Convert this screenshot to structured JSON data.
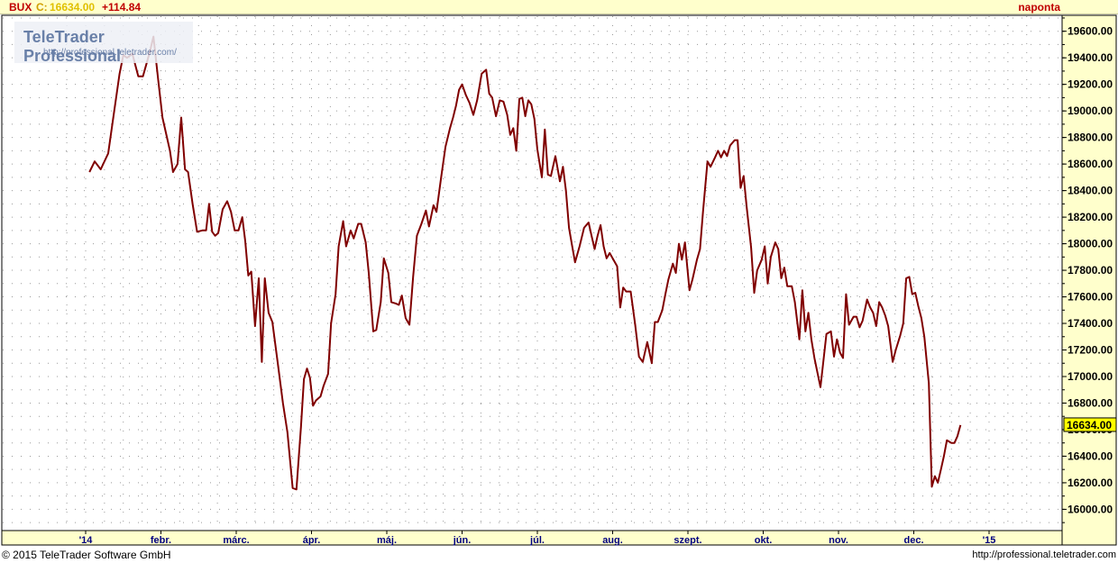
{
  "header": {
    "symbol": "BUX",
    "close_prefix": "C:",
    "close_value": "16634.00",
    "change": "+114.84",
    "interval": "naponta"
  },
  "logo": {
    "name": "TeleTrader Professional",
    "url": "http://professional.teletrader.com/"
  },
  "footer": {
    "copyright": "© 2015 TeleTrader Software GmbH",
    "url": "http://professional.teletrader.com"
  },
  "colors": {
    "line": "#800000",
    "grid": "#999999",
    "axis_strip": "#ffffcc",
    "x_labels": "#000080",
    "last_price_bg": "#ffff00"
  },
  "chart_data": {
    "type": "line",
    "title": "BUX",
    "last_price_label": "16634.00",
    "x_tick_labels": [
      "'14",
      "febr.",
      "márc.",
      "ápr.",
      "máj.",
      "jún.",
      "júl.",
      "aug.",
      "szept.",
      "okt.",
      "nov.",
      "dec.",
      "'15"
    ],
    "x_tick_month_index": [
      0,
      1,
      2,
      3,
      4,
      5,
      6,
      7,
      8,
      9,
      10,
      11,
      12
    ],
    "y_ticks": [
      16000,
      16200,
      16400,
      16600,
      16800,
      17000,
      17200,
      17400,
      17600,
      17800,
      18000,
      18200,
      18400,
      18600,
      18800,
      19000,
      19200,
      19400,
      19600
    ],
    "y_tick_labels": [
      "16000.00",
      "16200.00",
      "16400.00",
      "16600.00",
      "16800.00",
      "17000.00",
      "17200.00",
      "17400.00",
      "17600.00",
      "17800.00",
      "18000.00",
      "18200.00",
      "18400.00",
      "18600.00",
      "18800.00",
      "19000.00",
      "19200.00",
      "19400.00",
      "19600.00"
    ],
    "ylim": [
      15840,
      19720
    ],
    "xlim_months": [
      -0.1,
      12.25
    ],
    "grid": true,
    "series": [
      {
        "values": [
          [
            0.05,
            18540
          ],
          [
            0.12,
            18620
          ],
          [
            0.2,
            18560
          ],
          [
            0.3,
            18680
          ],
          [
            0.38,
            19000
          ],
          [
            0.45,
            19280
          ],
          [
            0.5,
            19420
          ],
          [
            0.55,
            19400
          ],
          [
            0.62,
            19430
          ],
          [
            0.7,
            19260
          ],
          [
            0.76,
            19260
          ],
          [
            0.85,
            19440
          ],
          [
            0.9,
            19560
          ],
          [
            0.96,
            19250
          ],
          [
            1.02,
            18950
          ],
          [
            1.08,
            18800
          ],
          [
            1.12,
            18700
          ],
          [
            1.16,
            18540
          ],
          [
            1.22,
            18600
          ],
          [
            1.27,
            18950
          ],
          [
            1.32,
            18560
          ],
          [
            1.36,
            18540
          ],
          [
            1.42,
            18300
          ],
          [
            1.48,
            18090
          ],
          [
            1.55,
            18100
          ],
          [
            1.6,
            18100
          ],
          [
            1.64,
            18300
          ],
          [
            1.68,
            18090
          ],
          [
            1.72,
            18060
          ],
          [
            1.76,
            18080
          ],
          [
            1.82,
            18260
          ],
          [
            1.88,
            18320
          ],
          [
            1.93,
            18240
          ],
          [
            1.98,
            18100
          ],
          [
            2.03,
            18100
          ],
          [
            2.08,
            18200
          ],
          [
            2.12,
            18020
          ],
          [
            2.16,
            17760
          ],
          [
            2.2,
            17790
          ],
          [
            2.25,
            17380
          ],
          [
            2.3,
            17740
          ],
          [
            2.34,
            17110
          ],
          [
            2.38,
            17740
          ],
          [
            2.43,
            17480
          ],
          [
            2.48,
            17410
          ],
          [
            2.55,
            17110
          ],
          [
            2.62,
            16800
          ],
          [
            2.68,
            16580
          ],
          [
            2.75,
            16160
          ],
          [
            2.8,
            16150
          ],
          [
            2.86,
            16620
          ],
          [
            2.9,
            16980
          ],
          [
            2.94,
            17060
          ],
          [
            2.98,
            16990
          ],
          [
            3.02,
            16780
          ],
          [
            3.06,
            16820
          ],
          [
            3.12,
            16850
          ],
          [
            3.16,
            16930
          ],
          [
            3.22,
            17020
          ],
          [
            3.26,
            17400
          ],
          [
            3.32,
            17620
          ],
          [
            3.36,
            17980
          ],
          [
            3.42,
            18170
          ],
          [
            3.46,
            17980
          ],
          [
            3.52,
            18100
          ],
          [
            3.56,
            18040
          ],
          [
            3.62,
            18150
          ],
          [
            3.66,
            18150
          ],
          [
            3.72,
            18010
          ],
          [
            3.76,
            17780
          ],
          [
            3.82,
            17340
          ],
          [
            3.86,
            17350
          ],
          [
            3.92,
            17560
          ],
          [
            3.96,
            17890
          ],
          [
            4.02,
            17780
          ],
          [
            4.06,
            17560
          ],
          [
            4.12,
            17550
          ],
          [
            4.16,
            17540
          ],
          [
            4.2,
            17610
          ],
          [
            4.25,
            17440
          ],
          [
            4.3,
            17390
          ],
          [
            4.35,
            17750
          ],
          [
            4.4,
            18060
          ],
          [
            4.46,
            18150
          ],
          [
            4.52,
            18250
          ],
          [
            4.56,
            18130
          ],
          [
            4.62,
            18290
          ],
          [
            4.66,
            18240
          ],
          [
            4.72,
            18490
          ],
          [
            4.78,
            18730
          ],
          [
            4.84,
            18870
          ],
          [
            4.88,
            18950
          ],
          [
            4.92,
            19040
          ],
          [
            4.96,
            19160
          ],
          [
            5.0,
            19200
          ],
          [
            5.05,
            19120
          ],
          [
            5.1,
            19060
          ],
          [
            5.15,
            18970
          ],
          [
            5.2,
            19080
          ],
          [
            5.26,
            19280
          ],
          [
            5.32,
            19310
          ],
          [
            5.36,
            19130
          ],
          [
            5.4,
            19100
          ],
          [
            5.45,
            18960
          ],
          [
            5.5,
            19080
          ],
          [
            5.55,
            19070
          ],
          [
            5.6,
            18970
          ],
          [
            5.64,
            18820
          ],
          [
            5.68,
            18870
          ],
          [
            5.72,
            18700
          ],
          [
            5.76,
            19090
          ],
          [
            5.8,
            19100
          ],
          [
            5.84,
            18960
          ],
          [
            5.88,
            19080
          ],
          [
            5.92,
            19050
          ],
          [
            5.96,
            18940
          ],
          [
            6.0,
            18710
          ],
          [
            6.06,
            18500
          ],
          [
            6.1,
            18860
          ],
          [
            6.14,
            18520
          ],
          [
            6.18,
            18510
          ],
          [
            6.24,
            18660
          ],
          [
            6.3,
            18470
          ],
          [
            6.34,
            18580
          ],
          [
            6.38,
            18400
          ],
          [
            6.42,
            18120
          ],
          [
            6.46,
            17990
          ],
          [
            6.5,
            17860
          ],
          [
            6.56,
            17980
          ],
          [
            6.62,
            18120
          ],
          [
            6.68,
            18160
          ],
          [
            6.72,
            18060
          ],
          [
            6.76,
            17960
          ],
          [
            6.8,
            18060
          ],
          [
            6.84,
            18140
          ],
          [
            6.88,
            17980
          ],
          [
            6.92,
            17890
          ],
          [
            6.96,
            17930
          ],
          [
            7.0,
            17890
          ],
          [
            7.06,
            17830
          ],
          [
            7.1,
            17520
          ],
          [
            7.14,
            17670
          ],
          [
            7.18,
            17640
          ],
          [
            7.24,
            17640
          ],
          [
            7.3,
            17390
          ],
          [
            7.35,
            17150
          ],
          [
            7.4,
            17110
          ],
          [
            7.46,
            17260
          ],
          [
            7.52,
            17100
          ],
          [
            7.56,
            17410
          ],
          [
            7.6,
            17410
          ],
          [
            7.66,
            17500
          ],
          [
            7.7,
            17620
          ],
          [
            7.74,
            17730
          ],
          [
            7.8,
            17850
          ],
          [
            7.84,
            17780
          ],
          [
            7.88,
            18000
          ],
          [
            7.92,
            17880
          ],
          [
            7.96,
            18010
          ],
          [
            8.02,
            17650
          ],
          [
            8.06,
            17730
          ],
          [
            8.12,
            17880
          ],
          [
            8.16,
            17960
          ],
          [
            8.2,
            18240
          ],
          [
            8.26,
            18620
          ],
          [
            8.3,
            18580
          ],
          [
            8.36,
            18650
          ],
          [
            8.4,
            18700
          ],
          [
            8.44,
            18650
          ],
          [
            8.48,
            18700
          ],
          [
            8.52,
            18660
          ],
          [
            8.56,
            18740
          ],
          [
            8.62,
            18780
          ],
          [
            8.66,
            18780
          ],
          [
            8.7,
            18420
          ],
          [
            8.74,
            18510
          ],
          [
            8.78,
            18280
          ],
          [
            8.84,
            17970
          ],
          [
            8.88,
            17630
          ],
          [
            8.92,
            17800
          ],
          [
            8.98,
            17880
          ],
          [
            9.02,
            17980
          ],
          [
            9.06,
            17700
          ],
          [
            9.1,
            17900
          ],
          [
            9.16,
            18010
          ],
          [
            9.2,
            17960
          ],
          [
            9.24,
            17740
          ],
          [
            9.28,
            17820
          ],
          [
            9.32,
            17680
          ],
          [
            9.38,
            17680
          ],
          [
            9.42,
            17560
          ],
          [
            9.48,
            17280
          ],
          [
            9.52,
            17650
          ],
          [
            9.56,
            17340
          ],
          [
            9.6,
            17480
          ],
          [
            9.64,
            17280
          ],
          [
            9.68,
            17140
          ],
          [
            9.76,
            16920
          ],
          [
            9.8,
            17120
          ],
          [
            9.84,
            17320
          ],
          [
            9.9,
            17340
          ],
          [
            9.94,
            17150
          ],
          [
            9.98,
            17280
          ],
          [
            10.02,
            17180
          ],
          [
            10.06,
            17140
          ],
          [
            10.1,
            17620
          ],
          [
            10.14,
            17390
          ],
          [
            10.2,
            17450
          ],
          [
            10.24,
            17450
          ],
          [
            10.28,
            17370
          ],
          [
            10.32,
            17420
          ],
          [
            10.38,
            17580
          ],
          [
            10.42,
            17520
          ],
          [
            10.46,
            17480
          ],
          [
            10.5,
            17380
          ],
          [
            10.54,
            17560
          ],
          [
            10.58,
            17520
          ],
          [
            10.62,
            17460
          ],
          [
            10.66,
            17380
          ],
          [
            10.72,
            17110
          ],
          [
            10.76,
            17200
          ],
          [
            10.82,
            17310
          ],
          [
            10.86,
            17400
          ],
          [
            10.9,
            17740
          ],
          [
            10.94,
            17750
          ],
          [
            10.98,
            17620
          ],
          [
            11.02,
            17630
          ],
          [
            11.06,
            17530
          ],
          [
            11.1,
            17440
          ],
          [
            11.14,
            17300
          ],
          [
            11.2,
            16950
          ],
          [
            11.24,
            16170
          ],
          [
            11.28,
            16250
          ],
          [
            11.32,
            16200
          ],
          [
            11.36,
            16300
          ],
          [
            11.4,
            16400
          ],
          [
            11.44,
            16520
          ],
          [
            11.5,
            16500
          ],
          [
            11.54,
            16500
          ],
          [
            11.58,
            16550
          ],
          [
            11.62,
            16634
          ]
        ]
      }
    ]
  }
}
